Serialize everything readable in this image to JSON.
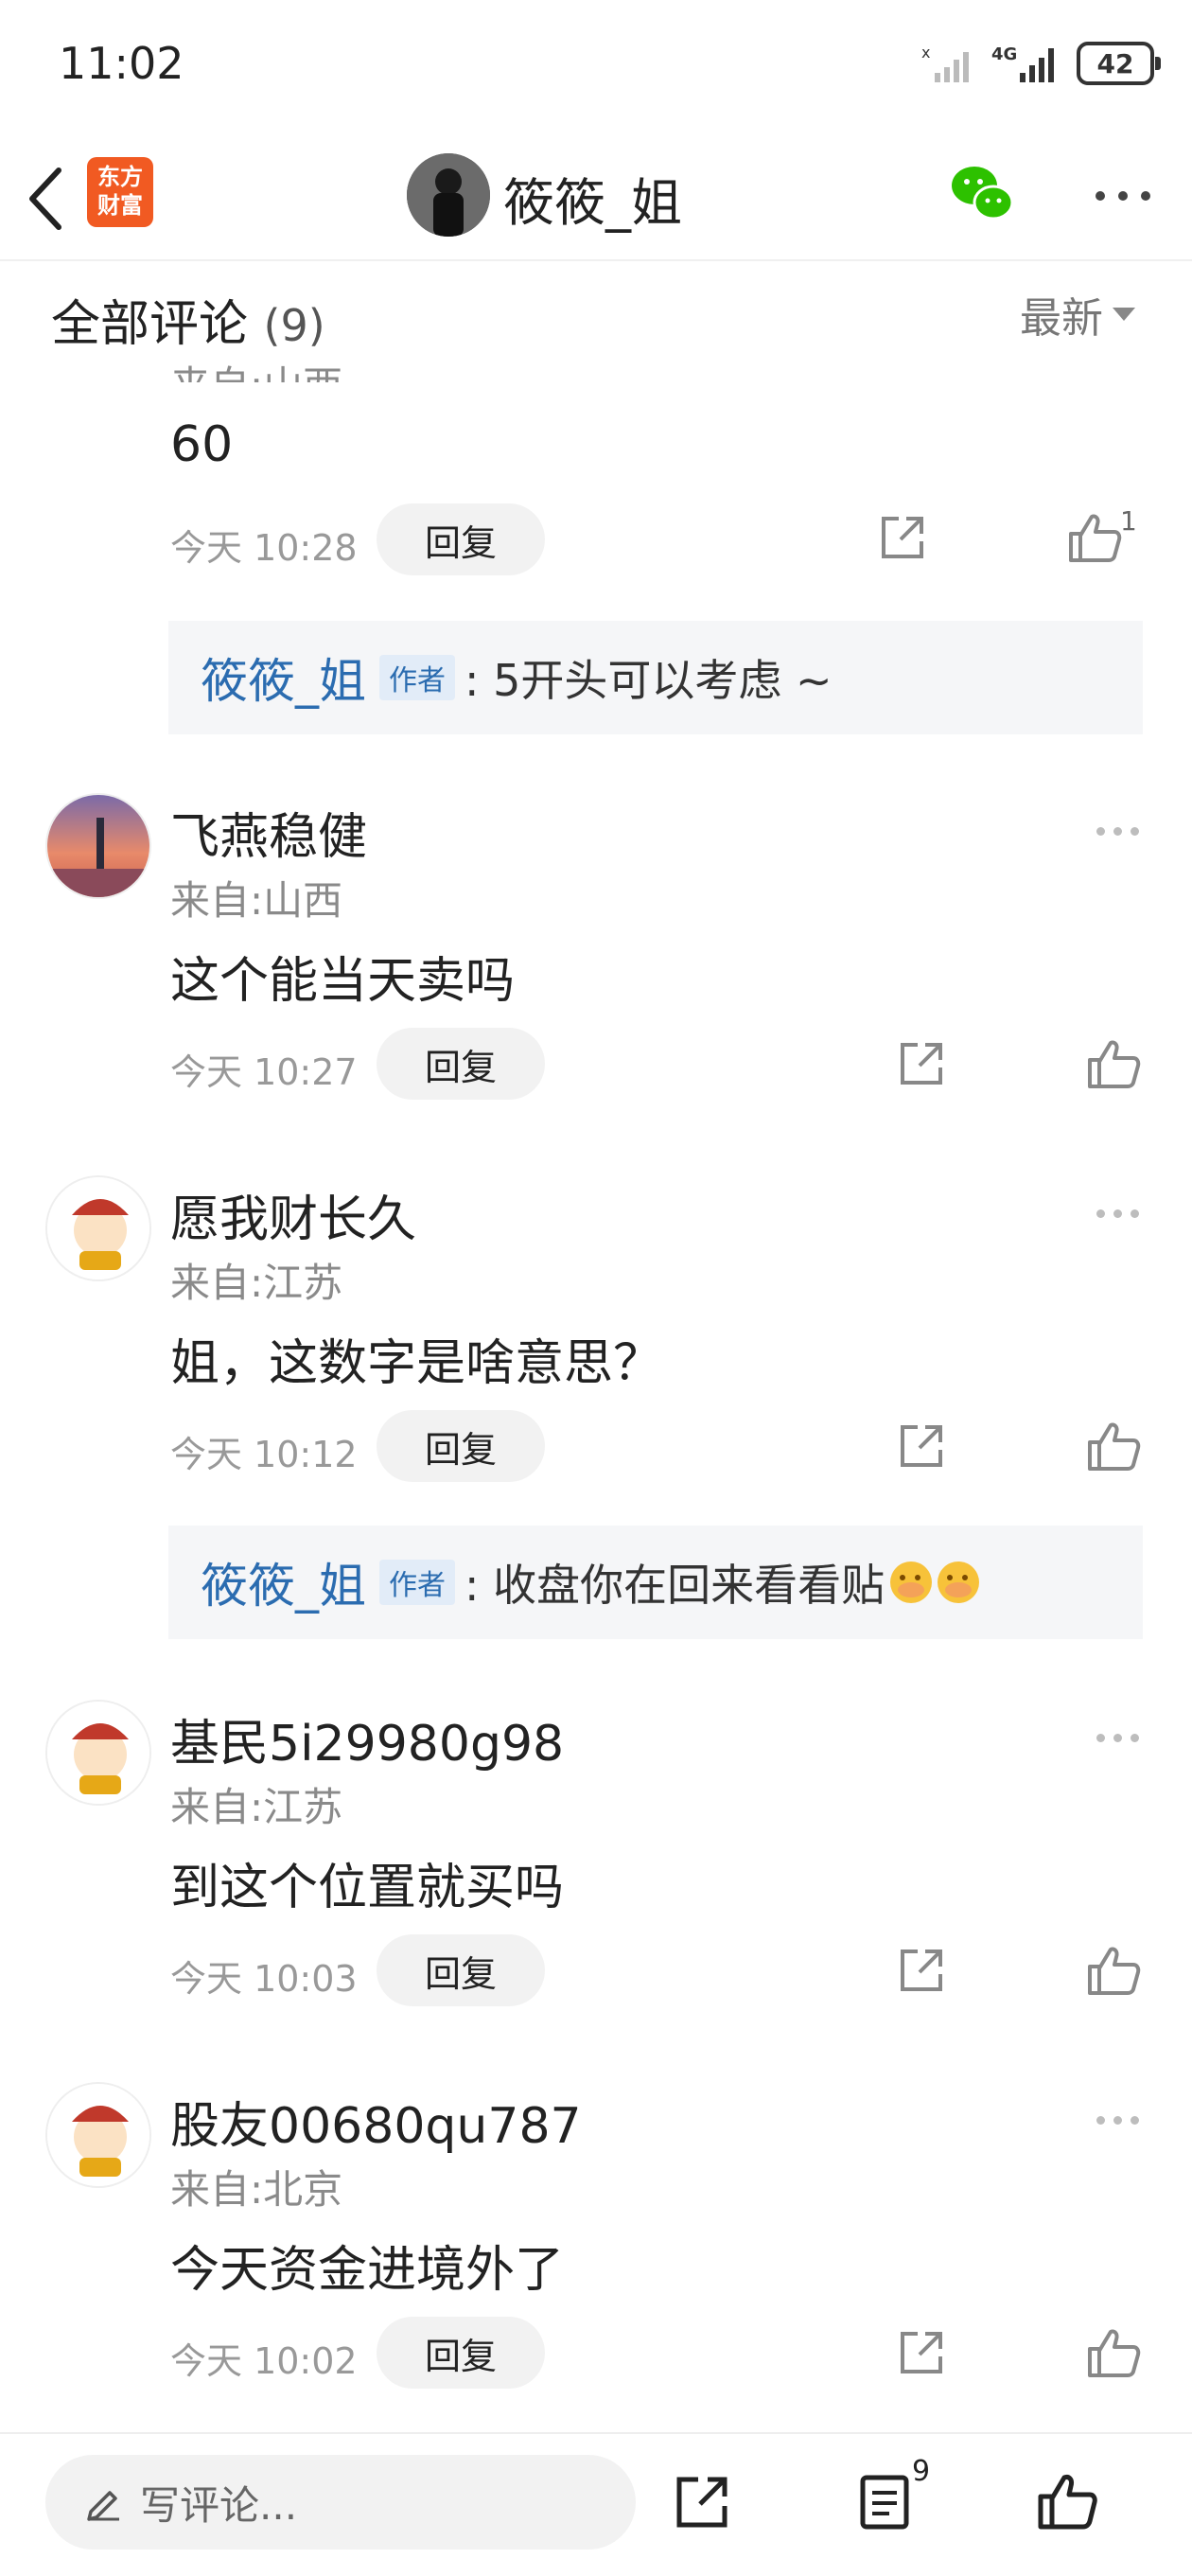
{
  "status_bar": {
    "time": "11:02",
    "network": "4G",
    "battery": "42"
  },
  "header": {
    "logo_line1": "东方",
    "logo_line2": "财富",
    "title": "筱筱_姐"
  },
  "comments_section": {
    "title": "全部评论",
    "count": "(9)",
    "sort": "最新"
  },
  "partial_comment": {
    "location": "来自:山西",
    "text": "60",
    "time": "今天 10:28",
    "reply": "回复",
    "likes": "1"
  },
  "author_reply_1": {
    "name": "筱筱_姐",
    "badge": "作者",
    "text": ": 5开头可以考虑 ~"
  },
  "comments": [
    {
      "name": "飞燕稳健",
      "location": "来自:山西",
      "text": "这个能当天卖吗",
      "time": "今天 10:27",
      "reply": "回复"
    },
    {
      "name": "愿我财长久",
      "location": "来自:江苏",
      "text": "姐，这数字是啥意思？",
      "time": "今天 10:12",
      "reply": "回复"
    },
    {
      "name": "基民5i29980g98",
      "location": "来自:江苏",
      "text": "到这个位置就买吗",
      "time": "今天 10:03",
      "reply": "回复"
    },
    {
      "name": "股友00680qu787",
      "location": "来自:北京",
      "text": "今天资金进境外了",
      "time": "今天 10:02",
      "reply": "回复"
    }
  ],
  "author_reply_2": {
    "name": "筱筱_姐",
    "badge": "作者",
    "text": ": 收盘你在回来看看贴"
  },
  "bottom_bar": {
    "write_placeholder": "写评论...",
    "comment_count": "9"
  },
  "icons": {
    "back": "chevron-left-icon",
    "wechat": "wechat-icon",
    "more": "more-dots-icon",
    "share": "share-icon",
    "like": "thumbs-up-icon",
    "pen": "pen-icon",
    "list": "comment-list-icon"
  }
}
